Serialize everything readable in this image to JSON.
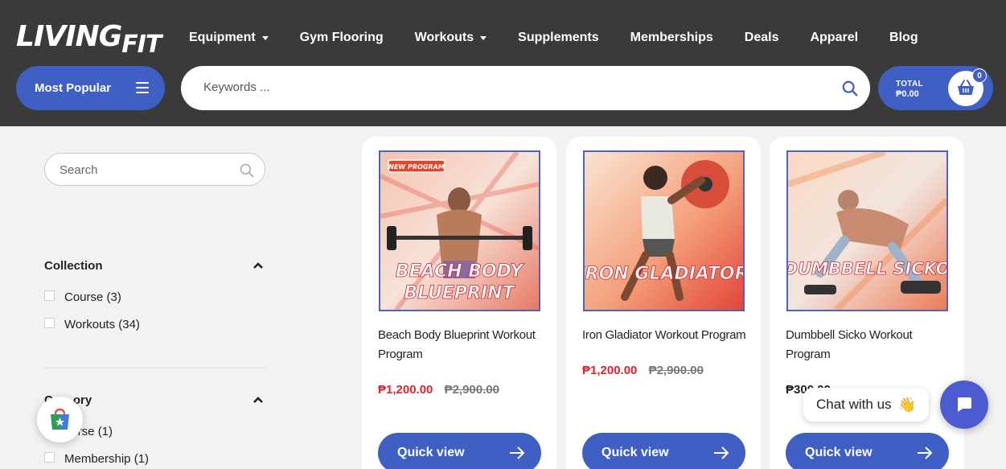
{
  "header": {
    "logo": "LIVINGFIT",
    "nav": [
      {
        "label": "Equipment",
        "dropdown": true
      },
      {
        "label": "Gym Flooring",
        "dropdown": false
      },
      {
        "label": "Workouts",
        "dropdown": true
      },
      {
        "label": "Supplements",
        "dropdown": false
      },
      {
        "label": "Memberships",
        "dropdown": false
      },
      {
        "label": "Deals",
        "dropdown": false
      },
      {
        "label": "Apparel",
        "dropdown": false
      },
      {
        "label": "Blog",
        "dropdown": false
      }
    ],
    "most_popular": "Most Popular",
    "search_placeholder": "Keywords ...",
    "cart": {
      "total_label": "TOTAL",
      "total_value": "₱0.00",
      "count": "0"
    }
  },
  "sidebar": {
    "search_placeholder": "Search",
    "collection": {
      "title": "Collection",
      "options": [
        "Course (3)",
        "Workouts (34)"
      ]
    },
    "category": {
      "title": "Category",
      "visible_title": "Ca    ory",
      "options": [
        "Course (1)",
        "Membership (1)"
      ],
      "visible_first_option": "ourse (1)"
    }
  },
  "products": [
    {
      "title": "Beach Body Blueprint Workout Program",
      "image_text": "BEACH BODY BLUEPRINT",
      "badge": "NEW PROGRAM",
      "price": "₱1,200.00",
      "old_price": "₱2,900.00",
      "button": "Quick view"
    },
    {
      "title": "Iron Gladiator Workout Program",
      "image_text": "IRON GLADIATOR",
      "price": "₱1,200.00",
      "old_price": "₱2,900.00",
      "button": "Quick view"
    },
    {
      "title": "Dumbbell Sicko Workout Program",
      "image_text": "DUMBBELL SICKO",
      "price": "₱300.00",
      "visible_price": "₱300.00",
      "button": "Quick view"
    }
  ],
  "chat": {
    "label": "Chat with us",
    "emoji": "👋"
  },
  "colors": {
    "header_bg": "#3a3a3a",
    "accent": "#3f5fc4",
    "sale": "#e0222a",
    "chat": "#4d5bd0"
  }
}
